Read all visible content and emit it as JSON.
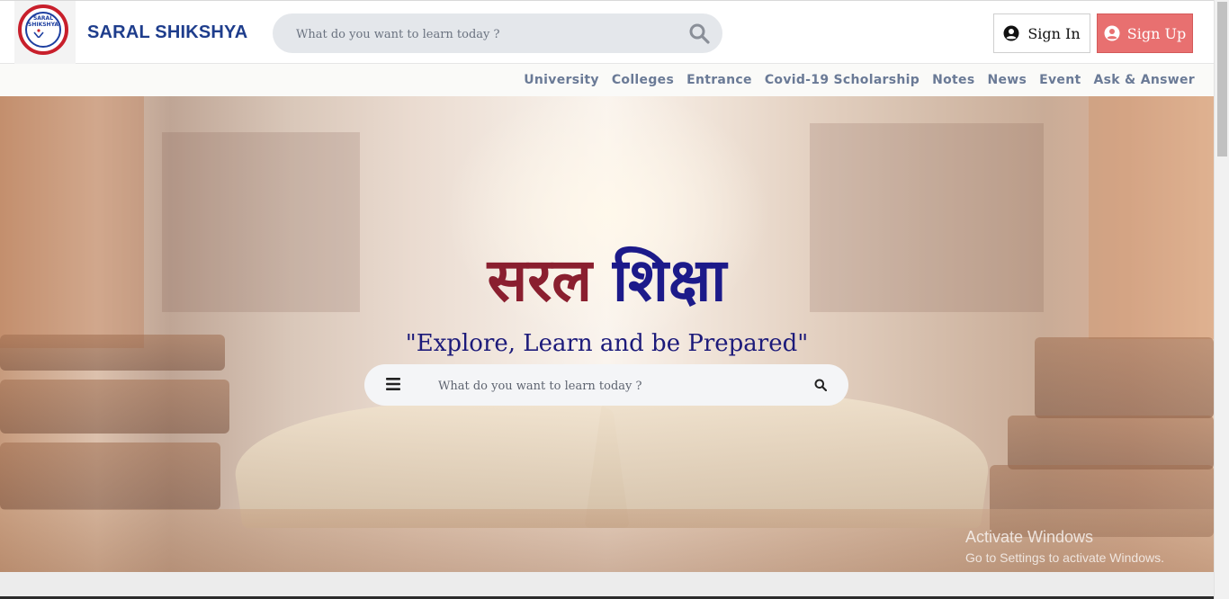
{
  "header": {
    "logo_text": "SARAL SHIKSHYA",
    "brand": "SARAL SHIKSHYA",
    "search": {
      "placeholder": "What do you want to learn today ?"
    },
    "sign_in": "Sign In",
    "sign_up": "Sign Up",
    "sign_up_color": "#e87070"
  },
  "nav": {
    "items": [
      {
        "label": "University"
      },
      {
        "label": "Colleges"
      },
      {
        "label": "Entrance"
      },
      {
        "label": "Covid-19 Scholarship"
      },
      {
        "label": "Notes"
      },
      {
        "label": "News"
      },
      {
        "label": "Event"
      },
      {
        "label": "Ask & Answer"
      }
    ]
  },
  "hero": {
    "title_word1": "सरल",
    "title_word2": "शिक्षा",
    "title_colors": [
      "#8a1f2f",
      "#1c1a8a"
    ],
    "tagline": "\"Explore, Learn and be Prepared\"",
    "search": {
      "placeholder": "What do you want to learn today ?"
    },
    "icons": [
      "menu-icon",
      "search-icon"
    ]
  },
  "os_watermark": {
    "line1": "Activate Windows",
    "line2": "Go to Settings to activate Windows."
  }
}
